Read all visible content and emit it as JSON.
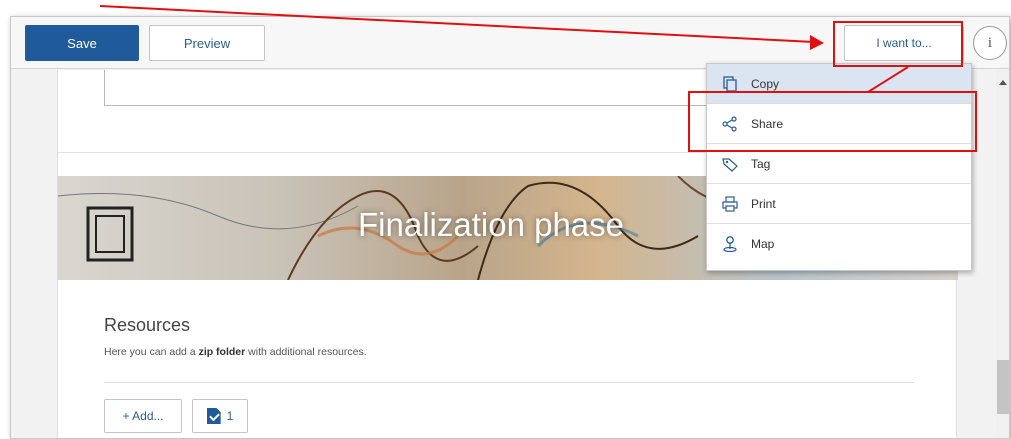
{
  "toolbar": {
    "save_label": "Save",
    "preview_label": "Preview",
    "i_want_to_label": "I want to...",
    "info_label": "i"
  },
  "menu": {
    "items": [
      {
        "label": "Copy",
        "icon": "copy-icon"
      },
      {
        "label": "Share",
        "icon": "share-icon"
      },
      {
        "label": "Tag",
        "icon": "tag-icon"
      },
      {
        "label": "Print",
        "icon": "print-icon"
      },
      {
        "label": "Map",
        "icon": "map-icon"
      }
    ],
    "highlighted": "Copy"
  },
  "banner": {
    "title": "Finalization phase"
  },
  "resources": {
    "title": "Resources",
    "description_prefix": "Here you can add a ",
    "description_bold": "zip folder",
    "description_suffix": " with additional resources.",
    "add_label": "+ Add...",
    "file_count": "1"
  },
  "colors": {
    "primary": "#1f5b9b",
    "link": "#2a5d96",
    "annotation": "#e01010",
    "menu_highlight": "#dbe5f1"
  }
}
